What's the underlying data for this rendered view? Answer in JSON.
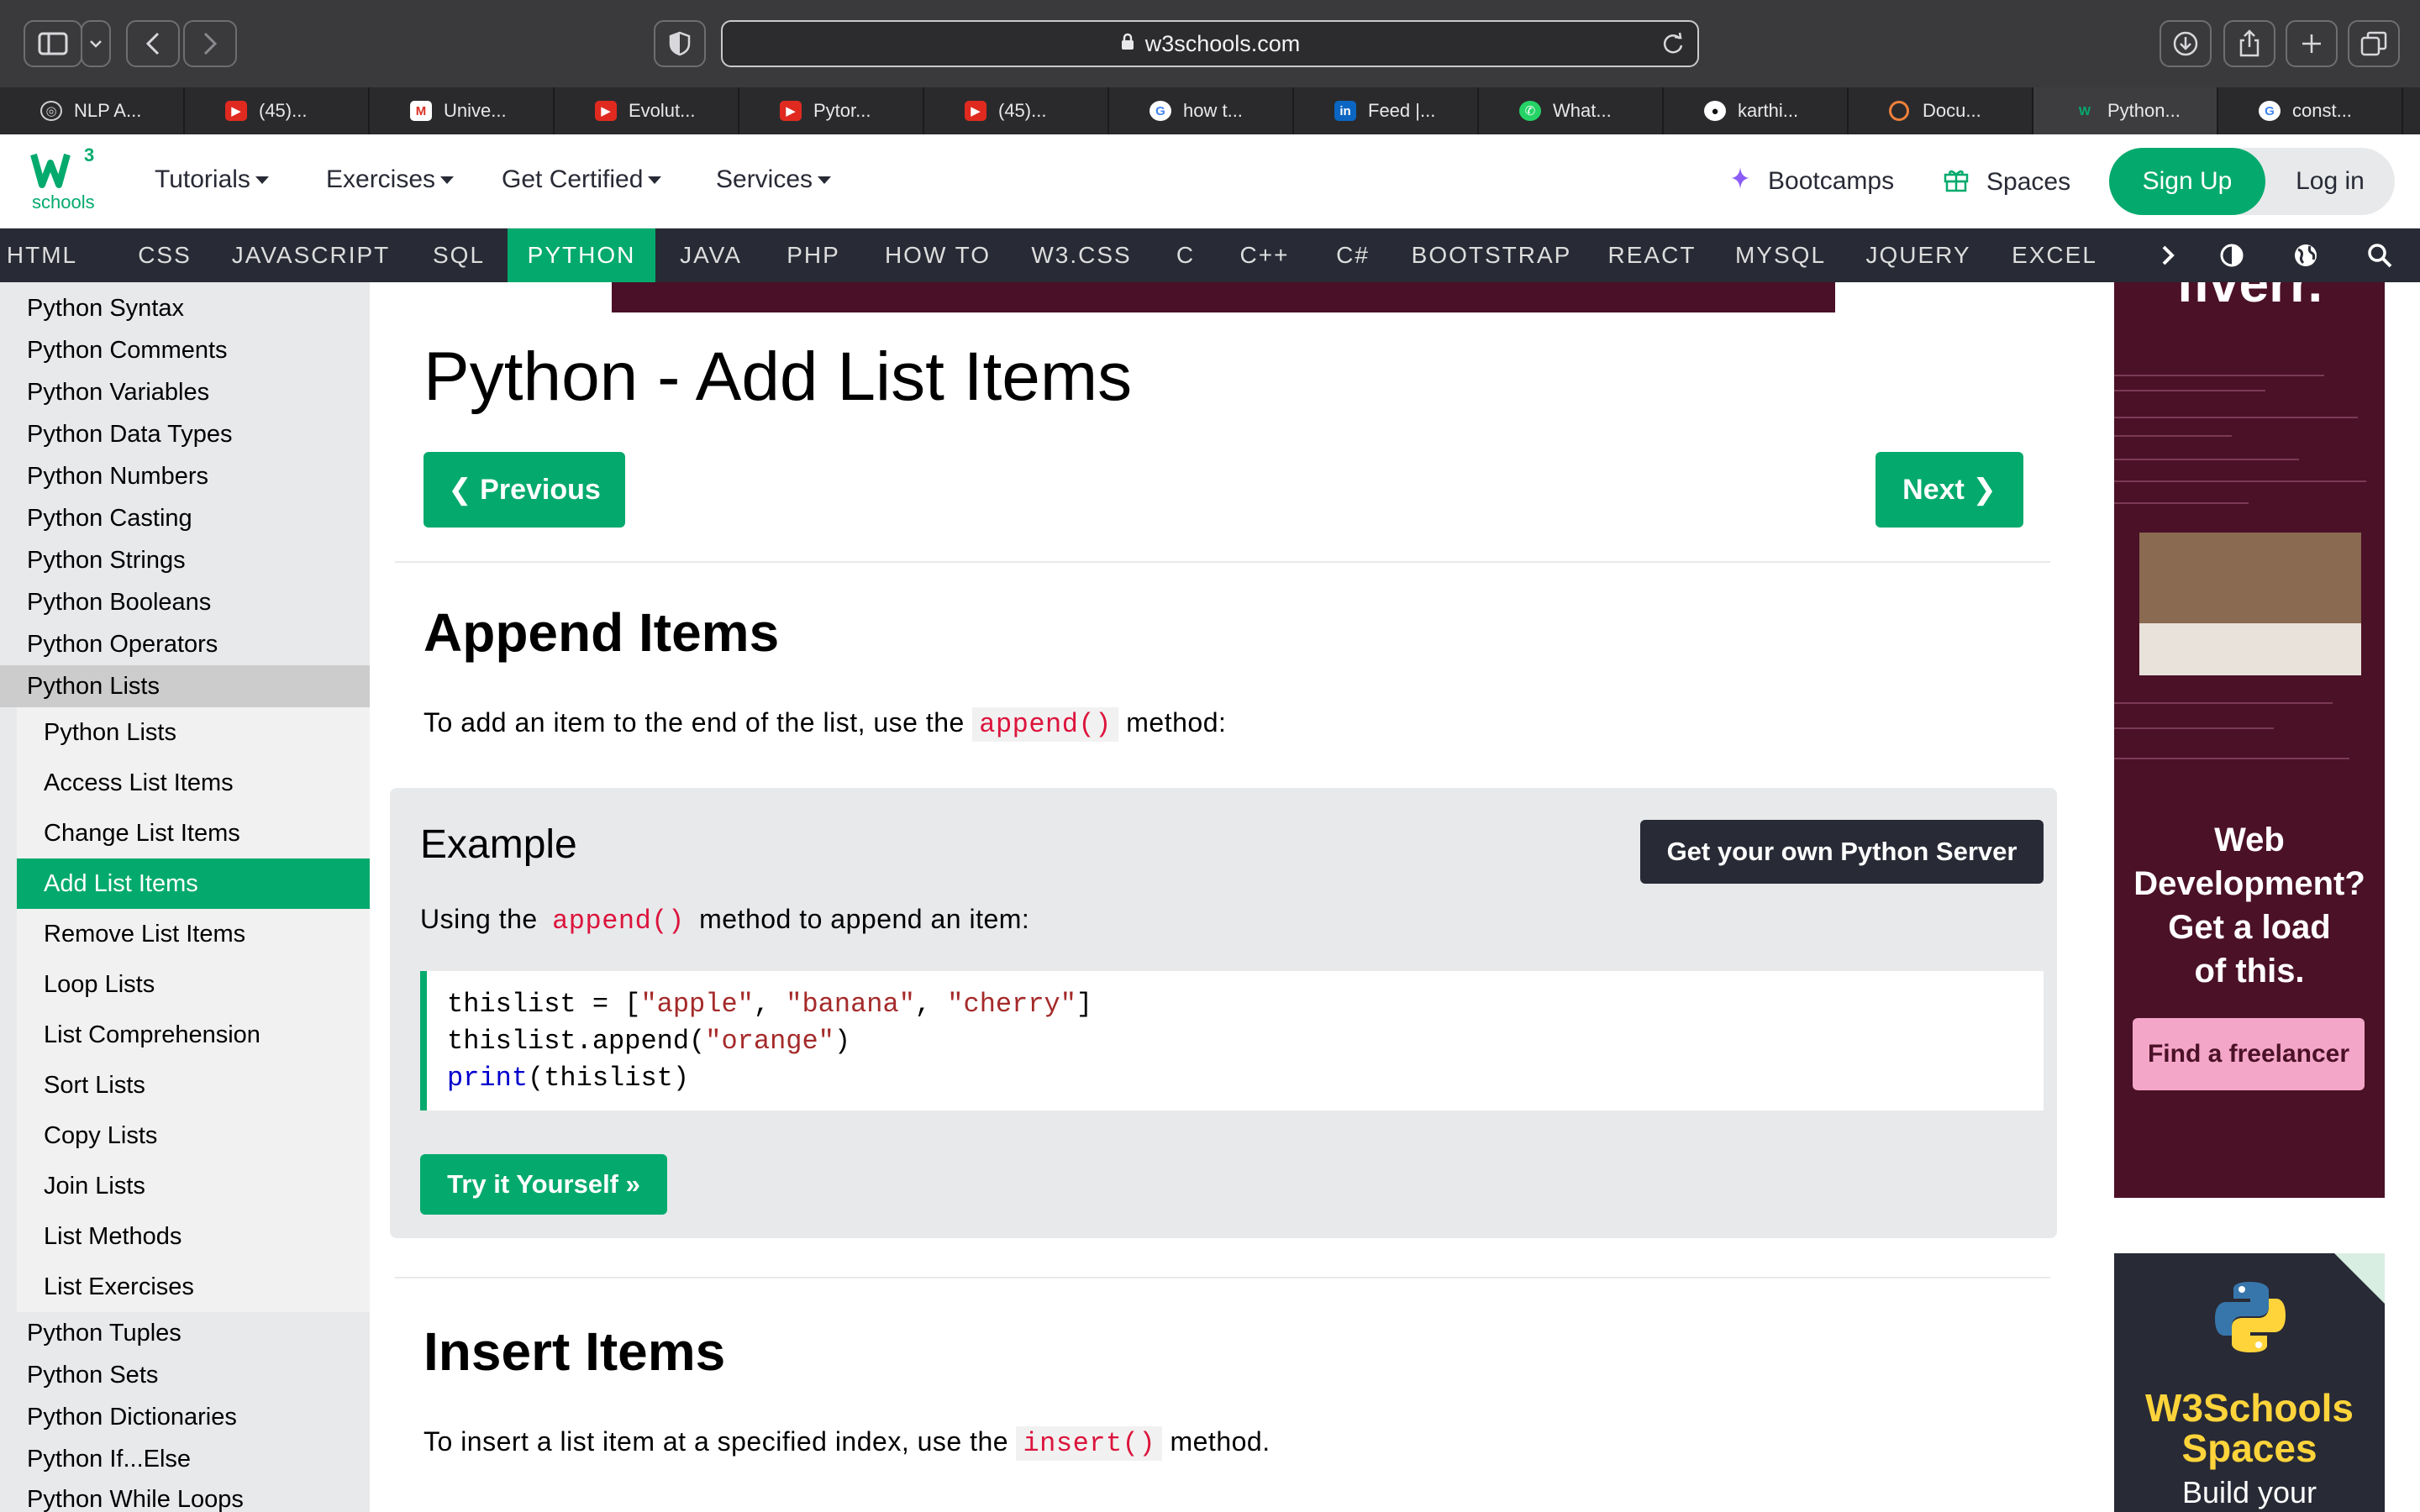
{
  "browser": {
    "url": "w3schools.com",
    "tabs": [
      {
        "title": "NLP A...",
        "icon": "openai-icon"
      },
      {
        "title": "(45)...",
        "icon": "youtube-icon"
      },
      {
        "title": "Unive...",
        "icon": "gmail-icon"
      },
      {
        "title": "Evolut...",
        "icon": "youtube-icon"
      },
      {
        "title": "Pytor...",
        "icon": "youtube-icon"
      },
      {
        "title": "(45)...",
        "icon": "youtube-icon"
      },
      {
        "title": "how t...",
        "icon": "google-icon"
      },
      {
        "title": "Feed |...",
        "icon": "linkedin-icon"
      },
      {
        "title": "What...",
        "icon": "whatsapp-icon"
      },
      {
        "title": "karthi...",
        "icon": "github-icon"
      },
      {
        "title": "Docu...",
        "icon": "document-icon"
      },
      {
        "title": "Python...",
        "icon": "w3schools-icon"
      },
      {
        "title": "const...",
        "icon": "google-icon"
      }
    ]
  },
  "topnav": {
    "logo_text": "schools",
    "logo_sup": "3",
    "menu": [
      "Tutorials",
      "Exercises",
      "Get Certified",
      "Services"
    ],
    "bootcamps": "Bootcamps",
    "spaces": "Spaces",
    "signup": "Sign Up",
    "login": "Log in"
  },
  "subnav": {
    "items": [
      "HTML",
      "CSS",
      "JAVASCRIPT",
      "SQL",
      "PYTHON",
      "JAVA",
      "PHP",
      "HOW TO",
      "W3.CSS",
      "C",
      "C++",
      "C#",
      "BOOTSTRAP",
      "REACT",
      "MYSQL",
      "JQUERY",
      "EXCEL"
    ],
    "active": "PYTHON"
  },
  "sidebar": {
    "top_items": [
      "Python Syntax",
      "Python Comments",
      "Python Variables",
      "Python Data Types",
      "Python Numbers",
      "Python Casting",
      "Python Strings",
      "Python Booleans",
      "Python Operators",
      "Python Lists"
    ],
    "sub_items": [
      "Python Lists",
      "Access List Items",
      "Change List Items",
      "Add List Items",
      "Remove List Items",
      "Loop Lists",
      "List Comprehension",
      "Sort Lists",
      "Copy Lists",
      "Join Lists",
      "List Methods",
      "List Exercises"
    ],
    "active_sub": "Add List Items",
    "bottom_items": [
      "Python Tuples",
      "Python Sets",
      "Python Dictionaries",
      "Python If...Else",
      "Python While Loops"
    ]
  },
  "main": {
    "title": "Python - Add List Items",
    "prev": "❮ Previous",
    "next": "Next ❯",
    "append_heading": "Append Items",
    "append_text_pre": "To add an item to the end of the list, use the",
    "append_code": "append()",
    "append_text_post": "method:",
    "example": {
      "title": "Example",
      "server_button": "Get your own Python Server",
      "desc_pre": "Using the",
      "desc_code": "append()",
      "desc_post": "method to append an item:",
      "code": {
        "line1_a": "thislist = [",
        "line1_s1": "\"apple\"",
        "line1_c1": ", ",
        "line1_s2": "\"banana\"",
        "line1_c2": ", ",
        "line1_s3": "\"cherry\"",
        "line1_end": "]",
        "line2_a": "thislist.append(",
        "line2_s": "\"orange\"",
        "line2_end": ")",
        "line3_kw": "print",
        "line3_rest": "(thislist)"
      },
      "try_button": "Try it Yourself »"
    },
    "insert_heading": "Insert Items",
    "insert_text_pre": "To insert a list item at a specified index, use the",
    "insert_code": "insert()",
    "insert_text_post": "method."
  },
  "ads": {
    "fiverr_text": "fiverr.",
    "ad1_lines": [
      "Web",
      "Development?",
      "Get a load",
      "of this."
    ],
    "ad1_button": "Find a freelancer",
    "ad2_title_1": "W3Schools",
    "ad2_title_2": "Spaces",
    "ad2_sub": "Build your"
  },
  "colors": {
    "w3_green": "#04aa6d",
    "dark_nav": "#282a35",
    "sidebar_bg": "#e7e9eb",
    "code_red": "#dc143c",
    "fiverr_bg": "#4b1127"
  }
}
